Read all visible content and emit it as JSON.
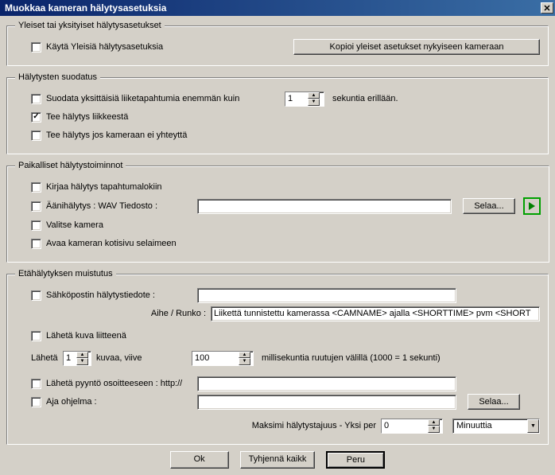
{
  "title": "Muokkaa kameran hälytysasetuksia",
  "group1": {
    "legend": "Yleiset tai yksityiset hälytysasetukset",
    "use_general": "Käytä Yleisiä hälytysasetuksia",
    "copy_btn": "Kopioi yleiset asetukset nykyiseen kameraan"
  },
  "group2": {
    "legend": "Hälytysten suodatus",
    "filter_label": "Suodata yksittäisiä liiketapahtumia enemmän kuin",
    "filter_value": "1",
    "filter_suffix": "sekuntia erillään.",
    "from_motion": "Tee hälytys liikkeestä",
    "from_no_contact": "Tee hälytys jos kameraan ei yhteyttä"
  },
  "group3": {
    "legend": "Paikalliset hälytystoiminnot",
    "log_event": "Kirjaa hälytys tapahtumalokiin",
    "wav_label": "Äänihälytys : WAV Tiedosto :",
    "browse": "Selaa...",
    "select_camera": "Valitse kamera",
    "open_homepage": "Avaa kameran kotisivu selaimeen"
  },
  "group4": {
    "legend": "Etähälytyksen muistutus",
    "email_label": "Sähköpostin hälytystiedote :",
    "subject_label": "Aihe / Runko :",
    "subject_value": "Liikettä tunnistettu kamerassa <CAMNAME> ajalla <SHORTTIME> pvm <SHORT",
    "attach_image": "Lähetä kuva liitteenä",
    "send_prefix": "Lähetä",
    "send_count": "1",
    "send_mid": "kuvaa, viive",
    "delay_value": "100",
    "delay_suffix": "millisekuntia ruutujen välillä (1000 = 1 sekunti)",
    "http_label": "Lähetä pyyntö osoitteeseen : http://",
    "run_prog": "Aja ohjelma :",
    "browse2": "Selaa...",
    "max_freq_label": "Maksimi hälytystajuus - Yksi per",
    "max_freq_value": "0",
    "max_freq_unit": "Minuuttia"
  },
  "footer": {
    "ok": "Ok",
    "clear": "Tyhjennä kaikk",
    "cancel": "Peru"
  }
}
